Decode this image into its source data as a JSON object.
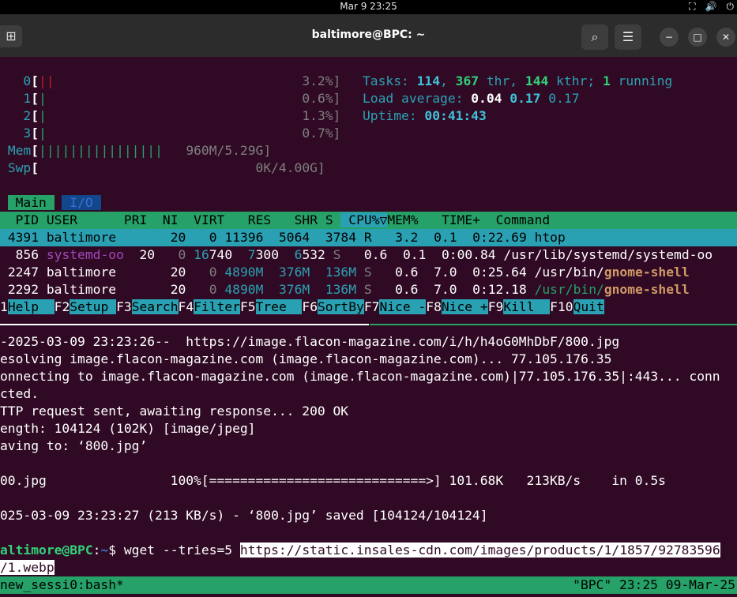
{
  "system_bar": {
    "datetime": "Mar 9  23:25",
    "tray_icons": [
      "network-icon",
      "volume-icon",
      "power-icon"
    ]
  },
  "window": {
    "title": "baltimore@BPC: ~",
    "new_tab_icon": "⊞",
    "search_icon": "⌕",
    "menu_icon": "☰",
    "minimize_icon": "−",
    "maximize_icon": "□",
    "close_icon": "✕"
  },
  "htop": {
    "cpus": [
      {
        "label": "0",
        "bar_pre": "[",
        "bar": "||",
        "percent": "3.2%]"
      },
      {
        "label": "1",
        "bar_pre": "[",
        "bar": "|",
        "percent": "0.6%]"
      },
      {
        "label": "2",
        "bar_pre": "[",
        "bar": "|",
        "percent": "1.3%]"
      },
      {
        "label": "3",
        "bar_pre": "[",
        "bar": "|",
        "percent": "0.7%]"
      }
    ],
    "mem": {
      "label": "Mem",
      "bar_pre": "[",
      "bar": "||||||||||||||||",
      "value": "960M/5.29G]"
    },
    "swp": {
      "label": "Swp",
      "bar_pre": "[",
      "value": "0K/4.00G]"
    },
    "tasks": {
      "label": "Tasks: ",
      "count": "114",
      "sep1": ", ",
      "threads": "367",
      "thr_label": " thr, ",
      "kthreads": "144",
      "kthr_label": " kthr; ",
      "running": "1",
      "running_label": " running"
    },
    "load": {
      "label": "Load average: ",
      "l1": "0.04",
      "l5": "0.17",
      "l15": "0.17"
    },
    "uptime": {
      "label": "Uptime: ",
      "value": "00:41:43"
    },
    "tabs": {
      "main": "Main",
      "io": "I/O"
    },
    "columns": {
      "pid": "PID",
      "user": "USER",
      "pri": "PRI",
      "ni": "NI",
      "virt": "VIRT",
      "res": "RES",
      "shr": "SHR",
      "s": "S",
      "cpu": "CPU%▽",
      "mem": "MEM%",
      "time": "TIME+",
      "cmd": "Command"
    },
    "processes": [
      {
        "pid": "4391",
        "user": "baltimore",
        "pri": "20",
        "ni": "0",
        "virt": "11396",
        "res": "5064",
        "shr": "3784",
        "s": "R",
        "cpu": "3.2",
        "mem": "0.1",
        "time": "0:22.69",
        "cmd_pre": "",
        "cmd_main": "htop"
      },
      {
        "pid": "856",
        "user": "systemd-oo",
        "pri": "20",
        "ni": "0",
        "virt_hi": "16",
        "virt": "740",
        "res_hi": "7",
        "res": "300",
        "shr_hi": "6",
        "shr": "532",
        "s": "S",
        "cpu": "0.6",
        "mem": "0.1",
        "time": "0:00.84",
        "cmd_pre": "",
        "cmd_main": "/usr/lib/systemd/systemd-oo"
      },
      {
        "pid": "2247",
        "user": "baltimore",
        "pri": "20",
        "ni": "0",
        "virt": "4890M",
        "res": "376M",
        "shr": "136M",
        "s": "S",
        "cpu": "0.6",
        "mem": "7.0",
        "time": "0:25.64",
        "cmd_pre": "/usr/bin/",
        "cmd_main": "gnome-shell"
      },
      {
        "pid": "2292",
        "user": "baltimore",
        "pri": "20",
        "ni": "0",
        "virt": "4890M",
        "res": "376M",
        "shr": "136M",
        "s": "S",
        "cpu": "0.6",
        "mem": "7.0",
        "time": "0:12.18",
        "cmd_pre": "/usr/bin/",
        "cmd_main": "gnome-shell"
      }
    ],
    "fkeys": [
      {
        "key": "1",
        "label": "Help  "
      },
      {
        "key": "F2",
        "label": "Setup "
      },
      {
        "key": "F3",
        "label": "Search"
      },
      {
        "key": "F4",
        "label": "Filter"
      },
      {
        "key": "F5",
        "label": "Tree  "
      },
      {
        "key": "F6",
        "label": "SortBy"
      },
      {
        "key": "F7",
        "label": "Nice -"
      },
      {
        "key": "F8",
        "label": "Nice +"
      },
      {
        "key": "F9",
        "label": "Kill  "
      },
      {
        "key": "F10",
        "label": "Quit"
      }
    ]
  },
  "wget_output": [
    "-2025-03-09 23:23:26--  https://image.flacon-magazine.com/i/h/h4oG0MhDbF/800.jpg",
    "esolving image.flacon-magazine.com (image.flacon-magazine.com)... 77.105.176.35",
    "onnecting to image.flacon-magazine.com (image.flacon-magazine.com)|77.105.176.35|:443... conn",
    "cted.",
    "TTP request sent, awaiting response... 200 OK",
    "ength: 104124 (102K) [image/jpeg]",
    "aving to: ‘800.jpg’",
    "",
    "00.jpg                100%[============================>] 101.68K   213KB/s    in 0.5s",
    "",
    "025-03-09 23:23:27 (213 KB/s) - ‘800.jpg’ saved [104124/104124]",
    ""
  ],
  "prompt": {
    "user_host": "altimore@BPC",
    "colon": ":",
    "path": "~",
    "dollar": "$ ",
    "command": "wget --tries=5 ",
    "url_line1": "https://static.insales-cdn.com/images/products/1/1857/92783596",
    "url_line2": "/1.webp"
  },
  "tmux": {
    "session": "new_sessi0:bash*",
    "status": "\"BPC\" 23:25 09-Mar-25"
  }
}
